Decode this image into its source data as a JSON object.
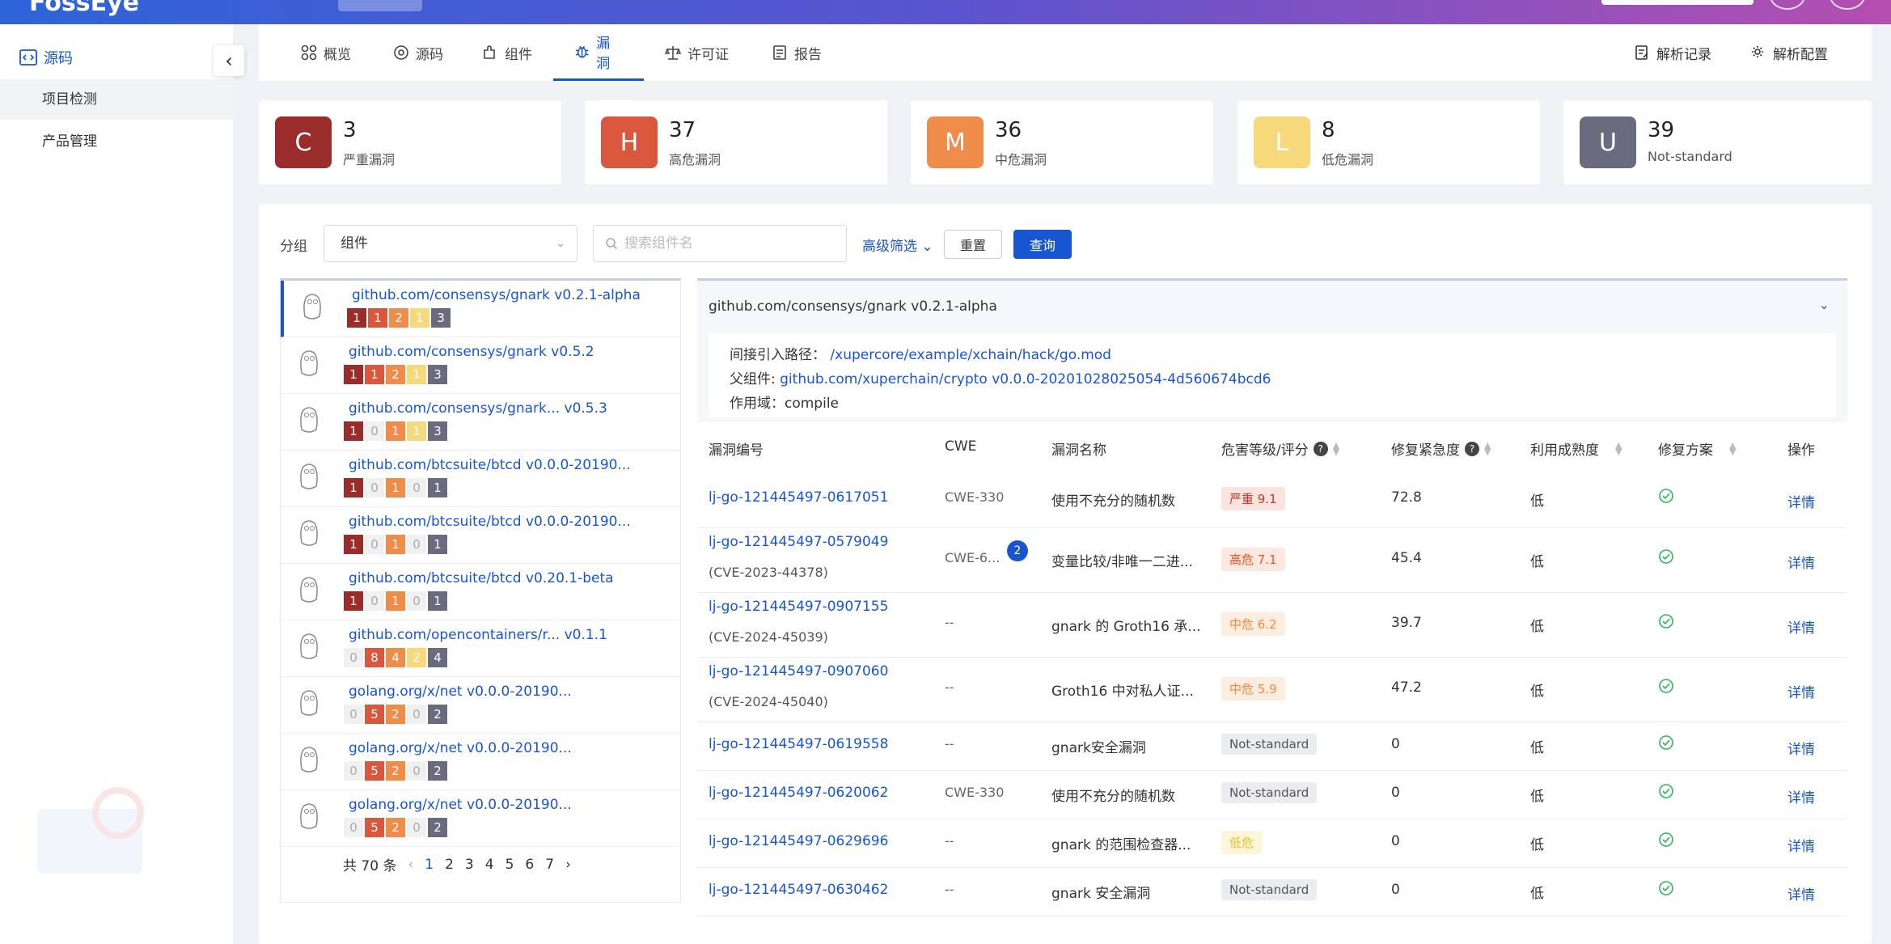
{
  "topbar": {
    "logo": "FossEye"
  },
  "sidebar": {
    "section": "源码",
    "items": [
      {
        "label": "项目检测"
      },
      {
        "label": "产品管理"
      }
    ]
  },
  "tabs": [
    {
      "label": "概览",
      "icon": "grid-icon"
    },
    {
      "label": "源码",
      "icon": "source-icon"
    },
    {
      "label": "组件",
      "icon": "puzzle-icon"
    },
    {
      "label": "漏洞",
      "icon": "bug-icon",
      "active": true
    },
    {
      "label": "许可证",
      "icon": "scale-icon"
    },
    {
      "label": "报告",
      "icon": "report-icon"
    }
  ],
  "tab_actions": {
    "parse_log": "解析记录",
    "parse_config": "解析配置"
  },
  "summary": [
    {
      "letter": "C",
      "count": "3",
      "label": "严重漏洞",
      "color": "#9b2c2c"
    },
    {
      "letter": "H",
      "count": "37",
      "label": "高危漏洞",
      "color": "#d9573d"
    },
    {
      "letter": "M",
      "count": "36",
      "label": "中危漏洞",
      "color": "#ef8c4a"
    },
    {
      "letter": "L",
      "count": "8",
      "label": "低危漏洞",
      "color": "#f5d97a"
    },
    {
      "letter": "U",
      "count": "39",
      "label": "Not-standard",
      "color": "#6b6b80"
    }
  ],
  "filter": {
    "group_label": "分组",
    "group_value": "组件",
    "search_placeholder": "搜索组件名",
    "advanced": "高级筛选",
    "reset": "重置",
    "query": "查询"
  },
  "components": [
    {
      "name": "github.com/consensys/gnark v0.2.1-alpha",
      "sev": [
        "1",
        "1",
        "2",
        "1",
        "3"
      ]
    },
    {
      "name": "github.com/consensys/gnark v0.5.2",
      "sev": [
        "1",
        "1",
        "2",
        "1",
        "3"
      ]
    },
    {
      "name": "github.com/consensys/gnark...   v0.5.3",
      "sev": [
        "1",
        "0",
        "1",
        "1",
        "3"
      ]
    },
    {
      "name": "github.com/btcsuite/btcd v0.0.0-20190...",
      "sev": [
        "1",
        "0",
        "1",
        "0",
        "1"
      ]
    },
    {
      "name": "github.com/btcsuite/btcd v0.0.0-20190...",
      "sev": [
        "1",
        "0",
        "1",
        "0",
        "1"
      ]
    },
    {
      "name": "github.com/btcsuite/btcd v0.20.1-beta",
      "sev": [
        "1",
        "0",
        "1",
        "0",
        "1"
      ]
    },
    {
      "name": "github.com/opencontainers/r...   v0.1.1",
      "sev": [
        "0",
        "8",
        "4",
        "2",
        "4"
      ]
    },
    {
      "name": "golang.org/x/net v0.0.0-20190...",
      "sev": [
        "0",
        "5",
        "2",
        "0",
        "2"
      ]
    },
    {
      "name": "golang.org/x/net v0.0.0-20190...",
      "sev": [
        "0",
        "5",
        "2",
        "0",
        "2"
      ]
    },
    {
      "name": "golang.org/x/net v0.0.0-20190...",
      "sev": [
        "0",
        "5",
        "2",
        "0",
        "2"
      ]
    }
  ],
  "pagination": {
    "total": "共 70 条",
    "pages": [
      "1",
      "2",
      "3",
      "4",
      "5",
      "6",
      "7"
    ],
    "current": "1"
  },
  "detail": {
    "title": "github.com/consensys/gnark v0.2.1-alpha",
    "path_label": "间接引入路径：",
    "path_value": "/xupercore/example/xchain/hack/go.mod",
    "parent_label": "父组件:",
    "parent_value": "github.com/xuperchain/crypto  v0.0.0-20201028025054-4d560674bcd6",
    "scope_label": "作用域：",
    "scope_value": "compile"
  },
  "table": {
    "headers": [
      "漏洞编号",
      "CWE",
      "漏洞名称",
      "危害等级/评分",
      "修复紧急度",
      "利用成熟度",
      "修复方案",
      "操作"
    ],
    "rows": [
      {
        "id": "lj-go-121445497-0617051",
        "cve": "",
        "cwe": "CWE-330",
        "name": "使用不充分的随机数",
        "level": "严重 9.1",
        "lvl": "crit",
        "urgency": "72.8",
        "maturity": "低",
        "action": "详情"
      },
      {
        "id": "lj-go-121445497-0579049",
        "cve": "(CVE-2023-44378)",
        "cwe": "CWE-6...",
        "cwe_count": "2",
        "name": "变量比较/非唯一二进...",
        "level": "高危 7.1",
        "lvl": "high",
        "urgency": "45.4",
        "maturity": "低",
        "action": "详情"
      },
      {
        "id": "lj-go-121445497-0907155",
        "cve": "(CVE-2024-45039)",
        "cwe": "--",
        "name": "gnark 的 Groth16 承...",
        "level": "中危 6.2",
        "lvl": "med",
        "urgency": "39.7",
        "maturity": "低",
        "action": "详情"
      },
      {
        "id": "lj-go-121445497-0907060",
        "cve": "(CVE-2024-45040)",
        "cwe": "--",
        "name": "Groth16 中对私人证...",
        "level": "中危 5.9",
        "lvl": "med",
        "urgency": "47.2",
        "maturity": "低",
        "action": "详情"
      },
      {
        "id": "lj-go-121445497-0619558",
        "cve": "",
        "cwe": "--",
        "name": "gnark安全漏洞",
        "level": "Not-standard",
        "lvl": "ns",
        "urgency": "0",
        "maturity": "低",
        "action": "详情"
      },
      {
        "id": "lj-go-121445497-0620062",
        "cve": "",
        "cwe": "CWE-330",
        "name": "使用不充分的随机数",
        "level": "Not-standard",
        "lvl": "ns",
        "urgency": "0",
        "maturity": "低",
        "action": "详情"
      },
      {
        "id": "lj-go-121445497-0629696",
        "cve": "",
        "cwe": "--",
        "name": "gnark 的范围检查器...",
        "level": "低危",
        "lvl": "low",
        "urgency": "0",
        "maturity": "低",
        "action": "详情"
      },
      {
        "id": "lj-go-121445497-0630462",
        "cve": "",
        "cwe": "--",
        "name": "gnark 安全漏洞",
        "level": "Not-standard",
        "lvl": "ns",
        "urgency": "0",
        "maturity": "低",
        "action": "详情"
      }
    ]
  }
}
